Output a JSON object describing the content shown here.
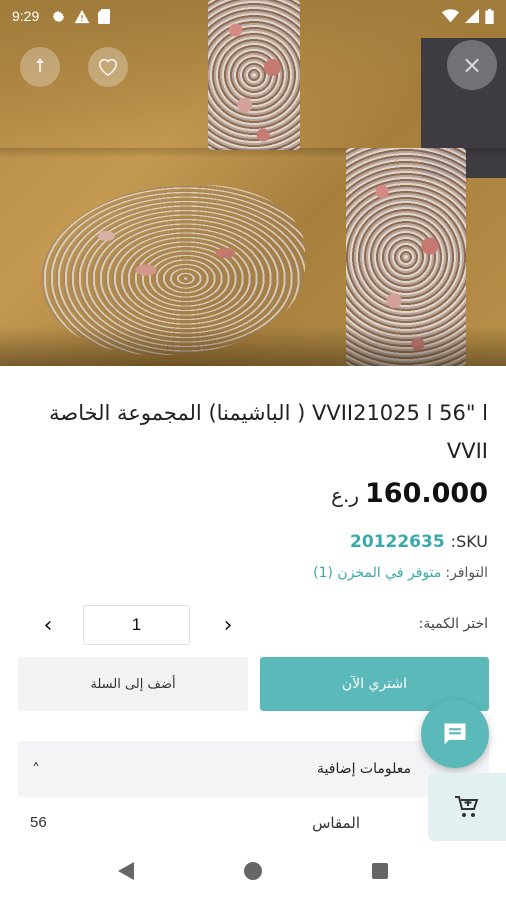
{
  "status_bar": {
    "time": "9:29",
    "left_icons": [
      "gear-icon",
      "warning-icon",
      "sim-card-icon"
    ],
    "right_icons": [
      "wifi-icon",
      "signal-icon",
      "battery-icon"
    ]
  },
  "image_overlay": {
    "share_icon": "share-icon",
    "favorite_icon": "heart-icon",
    "close_label": "×"
  },
  "product": {
    "title": "ا \"56 ا VVII21025 ( الباشيمنا) المجموعة الخاصة VVII",
    "price": "160.000",
    "currency": "ر.ع",
    "sku_label": "SKU:",
    "sku_value": "20122635",
    "availability_label": "التوافر:",
    "availability_value": "متوفر في المخزن (1)"
  },
  "quantity": {
    "label": "اختر الكمية:",
    "value": "1",
    "prev_symbol": "‹",
    "next_symbol": "›"
  },
  "actions": {
    "add_to_cart": "أضف إلى السلة",
    "buy_now": "اشتري الآن"
  },
  "additional_info": {
    "title": "معلومات إضافية",
    "chevron": "˄",
    "specs": [
      {
        "label": "المقاس",
        "value": "56"
      }
    ]
  },
  "colors": {
    "accent": "#5bb9b9",
    "sku": "#3aa9ac",
    "button_grey": "#f0f2f3"
  }
}
